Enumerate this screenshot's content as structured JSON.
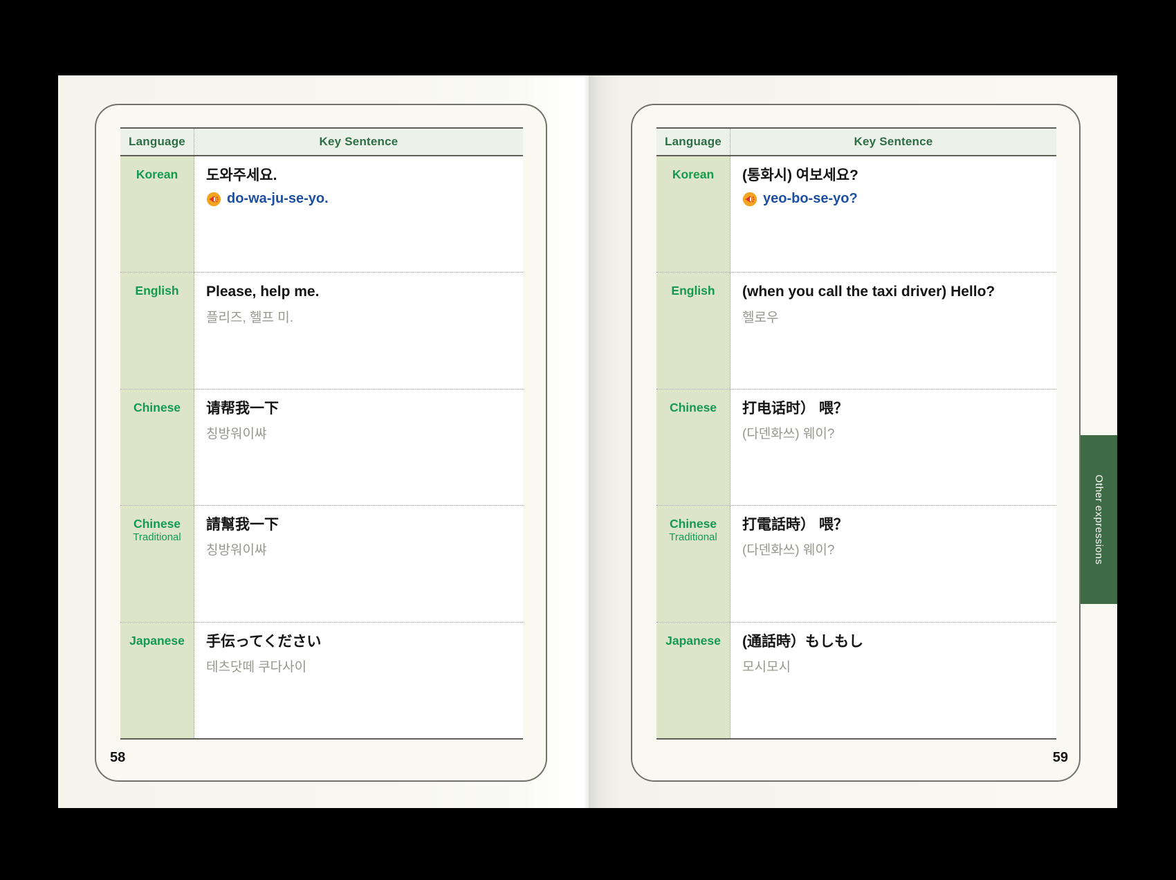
{
  "table_header": {
    "language": "Language",
    "key_sentence": "Key Sentence"
  },
  "side_tab": {
    "label": "Other expressions"
  },
  "pages": [
    {
      "number": "58",
      "rows": [
        {
          "language": "Korean",
          "main": "도와주세요.",
          "romanization": "do-wa-ju-se-yo.",
          "audio_icon": "megaphone"
        },
        {
          "language": "English",
          "main": "Please, help me.",
          "phonetic": "플리즈, 헬프 미."
        },
        {
          "language": "Chinese",
          "main": "请帮我一下",
          "phonetic": "칭방워이쌰"
        },
        {
          "language": "Chinese",
          "language_line2": "Traditional",
          "main": "請幫我一下",
          "phonetic": "칭방워이쌰"
        },
        {
          "language": "Japanese",
          "main": "手伝ってください",
          "phonetic": "테츠닷떼 쿠다사이"
        }
      ]
    },
    {
      "number": "59",
      "rows": [
        {
          "language": "Korean",
          "main": "(통화시) 여보세요?",
          "romanization": "yeo-bo-se-yo?",
          "audio_icon": "megaphone"
        },
        {
          "language": "English",
          "main": "(when you call the taxi driver) Hello?",
          "phonetic": "헬로우"
        },
        {
          "language": "Chinese",
          "main": "打电话时） 喂？",
          "phonetic": "(다덴화쓰) 웨이?"
        },
        {
          "language": "Chinese",
          "language_line2": "Traditional",
          "main": "打電話時） 喂？",
          "phonetic": "(다덴화쓰) 웨이?"
        },
        {
          "language": "Japanese",
          "main": "(通話時）もしもし",
          "phonetic": "모시모시"
        }
      ]
    }
  ],
  "colors": {
    "label_green": "#149a4e",
    "header_green": "#2e6e46",
    "tab_green": "#3e6b46",
    "language_column_bg": "#dde5c8",
    "header_row_bg": "#ecf2e9",
    "romanization_blue": "#1d4fa1",
    "phonetic_gray": "#97978f",
    "paper_cream": "#f7f6ef"
  }
}
